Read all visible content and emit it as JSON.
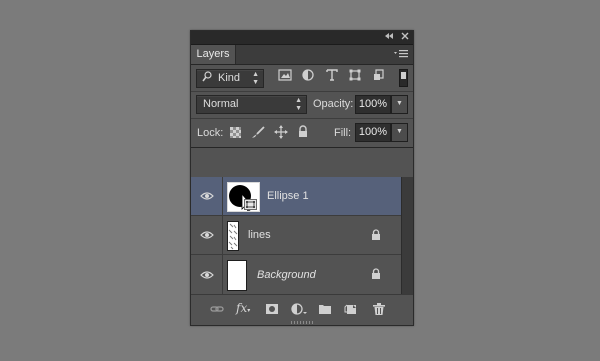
{
  "panel": {
    "tab_label": "Layers",
    "titlebar_icons": [
      "collapse-icon",
      "close-icon"
    ],
    "menu_icon": "panel-menu-icon"
  },
  "filter": {
    "kind_label": "Kind",
    "icons": [
      "pixel-filter-icon",
      "adjustment-filter-icon",
      "type-filter-icon",
      "shape-filter-icon",
      "smart-object-filter-icon",
      "filter-toggle-icon"
    ]
  },
  "blend": {
    "mode": "Normal",
    "opacity_label": "Opacity:",
    "opacity_value": "100%"
  },
  "lock": {
    "label": "Lock:",
    "icons": [
      "lock-transparent-pixels-icon",
      "lock-image-pixels-icon",
      "lock-position-icon",
      "lock-all-icon"
    ],
    "fill_label": "Fill:",
    "fill_value": "100%"
  },
  "layers": [
    {
      "name": "Ellipse 1",
      "selected": true,
      "locked": false,
      "italic": false
    },
    {
      "name": "lines",
      "selected": false,
      "locked": true,
      "italic": false
    },
    {
      "name": "Background",
      "selected": false,
      "locked": true,
      "italic": true
    }
  ],
  "bottom_icons": [
    "link-layers-icon",
    "fx-icon",
    "add-mask-icon",
    "new-adjustment-layer-icon",
    "new-group-icon",
    "new-layer-icon",
    "delete-layer-icon"
  ],
  "bottom_fx_label": "fx",
  "colors": {
    "panel_bg": "#535353",
    "selected_row": "#56617a",
    "background": "#7b7b7b"
  }
}
